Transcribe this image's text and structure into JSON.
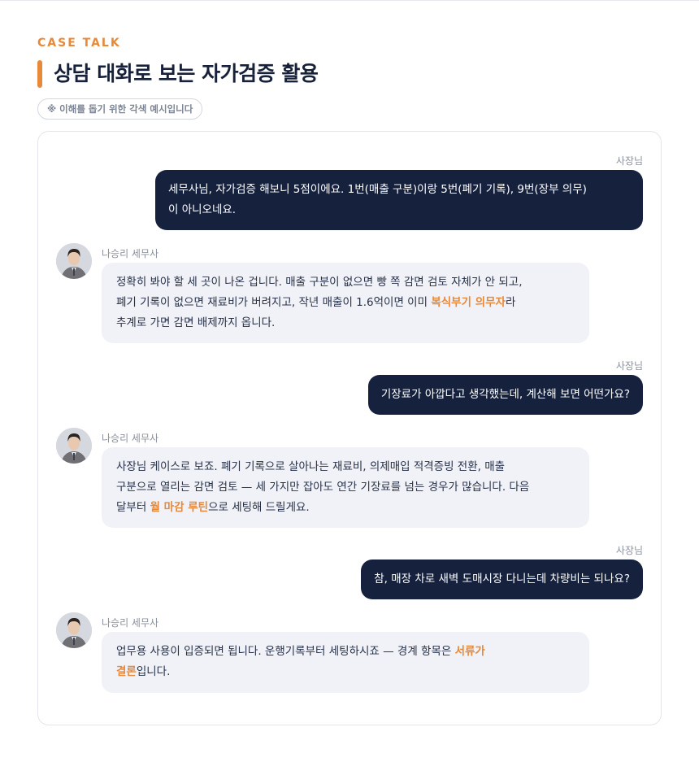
{
  "header": {
    "eyebrow": "CASE TALK",
    "title": "상담 대화로 보는 자가검증 활용",
    "note": "※ 이해를 돕기 위한 각색 예시입니다"
  },
  "colors": {
    "accent": "#e8893a",
    "owner_bubble": "#16223d",
    "advisor_bubble": "#f1f2f7"
  },
  "messages": [
    {
      "speaker": "사장님",
      "text_1": "세무사님, 자가검증 해보니 5점이에요. 1번(매출 구분)이랑 5번(폐기 기록), 9번(장부 의무)",
      "text_2": "이 아니오네요."
    },
    {
      "speaker": "나승리 세무사",
      "avatar_icon": "advisor-avatar",
      "text_1": "정확히 봐야 할 세 곳이 나온 겁니다. 매출 구분이 없으면 빵 쪽 감면 검토 자체가 안 되고,",
      "text_2a": "폐기 기록이 없으면 재료비가 버려지고, 작년 매출이 1.6억이면 이미 ",
      "text_2hl": "복식부기 의무자",
      "text_2b": "라",
      "text_3": "추계로 가면 감면 배제까지 옵니다."
    },
    {
      "speaker": "사장님",
      "text_1": "기장료가 아깝다고 생각했는데, 계산해 보면 어떤가요?"
    },
    {
      "speaker": "나승리 세무사",
      "avatar_icon": "advisor-avatar",
      "text_1": "사장님 케이스로 보죠. 폐기 기록으로 살아나는 재료비, 의제매입 적격증빙 전환, 매출",
      "text_2": "구분으로 열리는 감면 검토 — 세 가지만 잡아도 연간 기장료를 넘는 경우가 많습니다. 다음",
      "text_3a": "달부터 ",
      "text_3hl": "월 마감 루틴",
      "text_3b": "으로 세팅해 드릴게요."
    },
    {
      "speaker": "사장님",
      "text_1": "참, 매장 차로 새벽 도매시장 다니는데 차량비는 되나요?"
    },
    {
      "speaker": "나승리 세무사",
      "avatar_icon": "advisor-avatar",
      "text_1a": "업무용 사용이 입증되면 됩니다. 운행기록부터 세팅하시죠 — 경계 항목은 ",
      "text_1hl": "서류가",
      "text_2hl": "결론",
      "text_2b": "입니다."
    }
  ]
}
